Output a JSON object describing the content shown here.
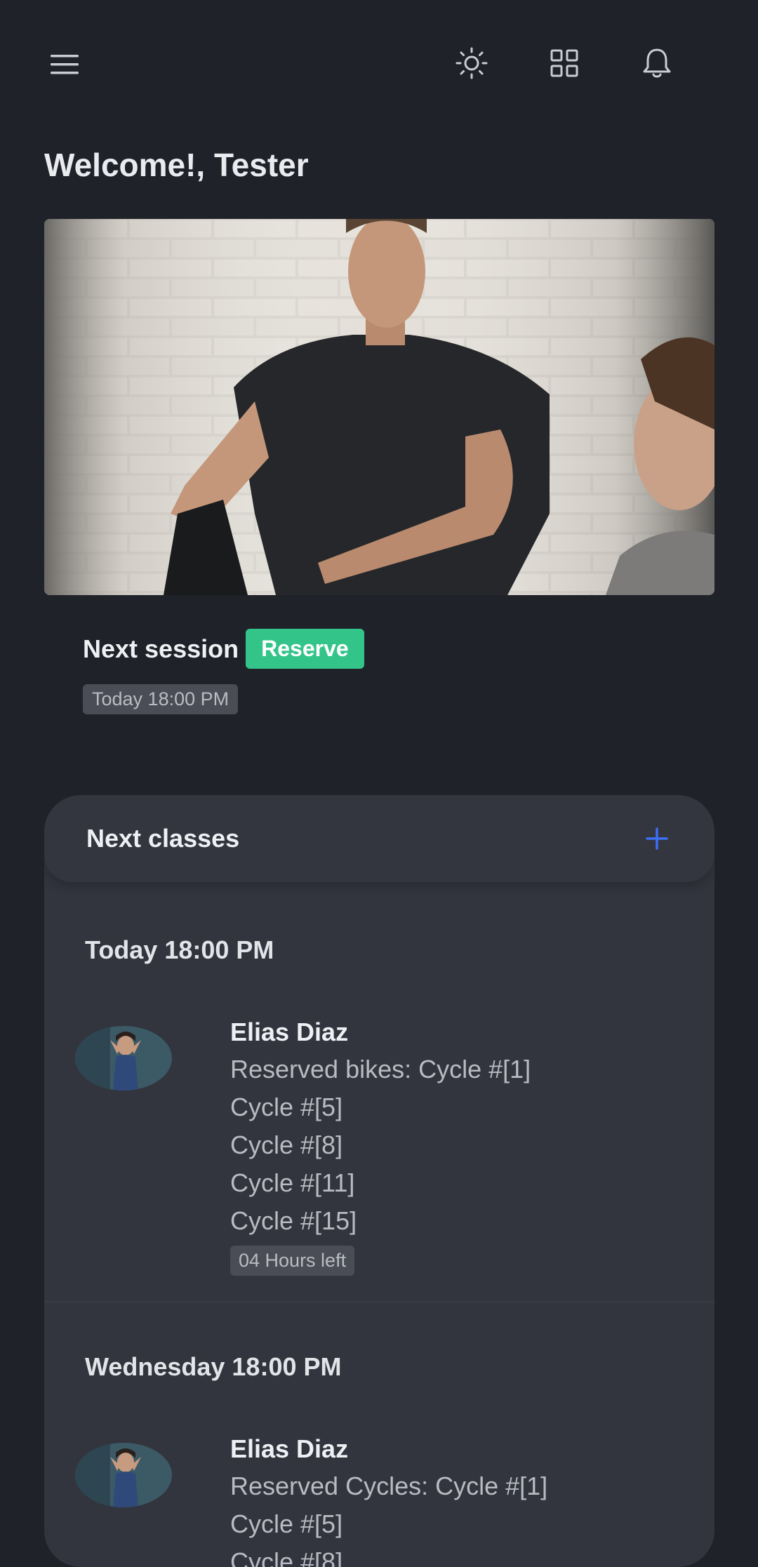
{
  "header": {
    "icons": [
      "menu-icon",
      "sun-icon",
      "grid-icon",
      "bell-icon"
    ]
  },
  "welcome": "Welcome!, Tester",
  "next_session": {
    "label": "Next session",
    "reserve_label": "Reserve",
    "time": "Today 18:00 PM"
  },
  "next_classes": {
    "title": "Next classes",
    "groups": [
      {
        "day": "Today 18:00 PM",
        "instructor": "Elias Diaz",
        "lines": [
          "Reserved bikes: Cycle #[1]",
          "Cycle #[5]",
          "Cycle #[8]",
          "Cycle #[11]",
          "Cycle #[15]"
        ],
        "time_left": "04 Hours left"
      },
      {
        "day": "Wednesday 18:00 PM",
        "instructor": "Elias Diaz",
        "lines": [
          "Reserved Cycles: Cycle #[1]",
          "Cycle #[5]",
          "Cycle #[8]"
        ]
      }
    ]
  },
  "colors": {
    "background": "#1f2228",
    "card": "#32353e",
    "accent_green": "#33c48a",
    "accent_blue": "#3b6ff5"
  }
}
